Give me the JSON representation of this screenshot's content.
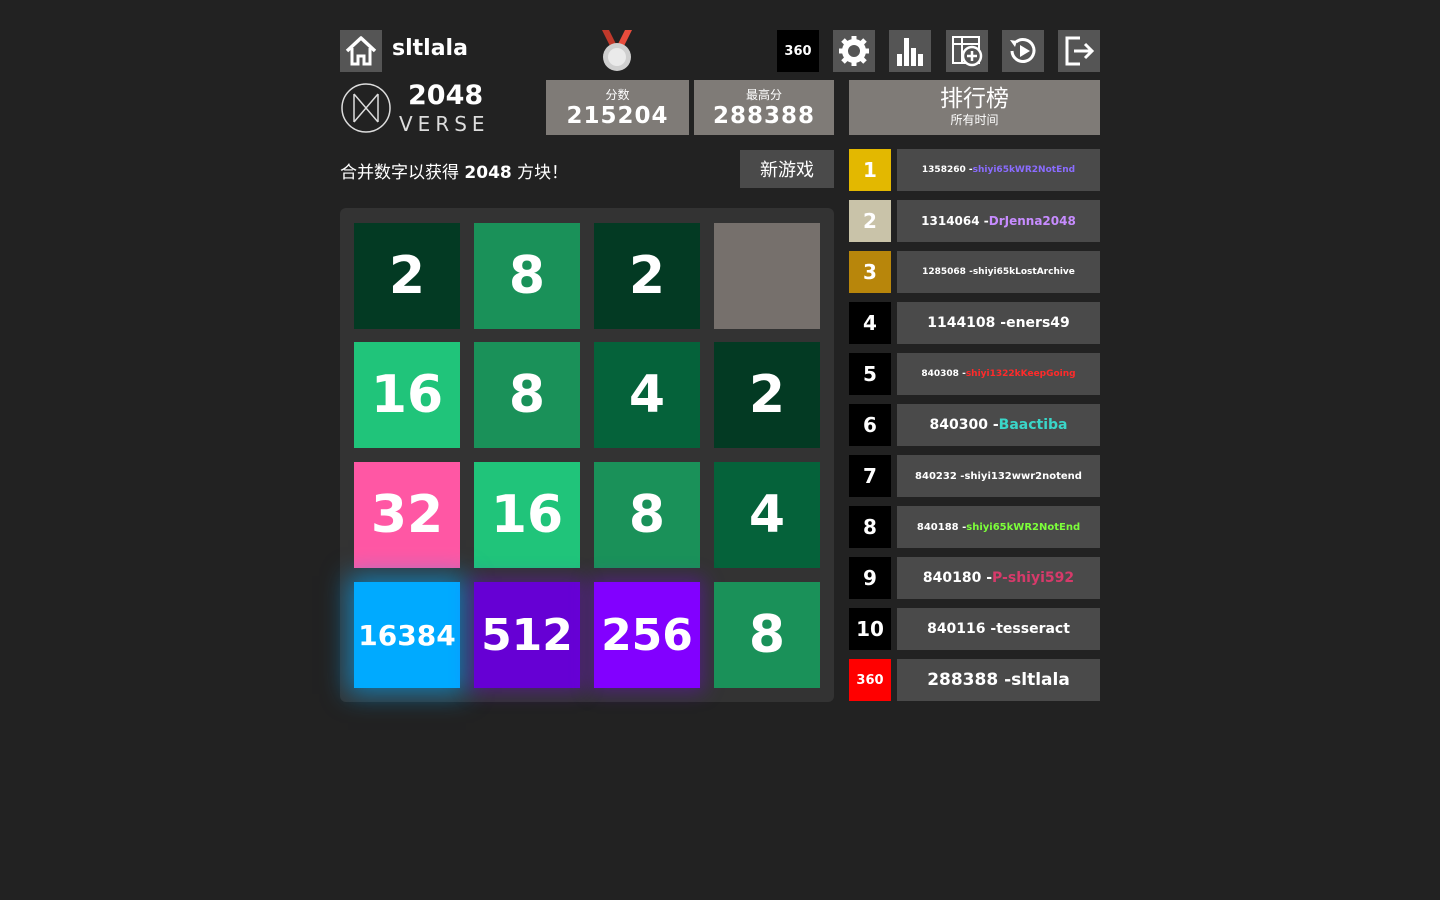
{
  "header": {
    "username": "sltlala",
    "rank_badge": "360",
    "icons": [
      "home-icon",
      "medal-icon",
      "gear-icon",
      "stats-icon",
      "grid-plus-icon",
      "replay-icon",
      "logout-icon"
    ]
  },
  "logo": {
    "number": "2048",
    "word": "VERSE"
  },
  "score": {
    "label": "分数",
    "value": "215204"
  },
  "best": {
    "label": "最高分",
    "value": "288388"
  },
  "leaderboard": {
    "title": "排行榜",
    "subtitle": "所有时间",
    "entries": [
      {
        "rank": "1",
        "score": "1358260",
        "name": "shiyi65kWR2NotEnd",
        "rank_color": "#e3b800",
        "name_color": "#8a6cff",
        "size": 9
      },
      {
        "rank": "2",
        "score": "1314064",
        "name": "DrJenna2048",
        "rank_color": "#c9c3a9",
        "name_color": "#c78cff",
        "size": 12
      },
      {
        "rank": "3",
        "score": "1285068",
        "name": "shiyi65kLostArchive",
        "rank_color": "#b8860b",
        "name_color": "#ffffff",
        "size": 9
      },
      {
        "rank": "4",
        "score": "1144108",
        "name": "eners49",
        "rank_color": "#000000",
        "name_color": "#ffffff",
        "size": 14
      },
      {
        "rank": "5",
        "score": "840308",
        "name": "shiyi1322kKeepGoing",
        "rank_color": "#000000",
        "name_color": "#ff2a2a",
        "size": 9
      },
      {
        "rank": "6",
        "score": "840300",
        "name": "Baactiba",
        "rank_color": "#000000",
        "name_color": "#3ad6c8",
        "size": 14
      },
      {
        "rank": "7",
        "score": "840232",
        "name": "shiyi132wwr2notend",
        "rank_color": "#000000",
        "name_color": "#ffffff",
        "size": 10
      },
      {
        "rank": "8",
        "score": "840188",
        "name": "shiyi65kWR2NotEnd",
        "rank_color": "#000000",
        "name_color": "#7cff3a",
        "size": 10
      },
      {
        "rank": "9",
        "score": "840180",
        "name": "P-shiyi592",
        "rank_color": "#000000",
        "name_color": "#d63a6a",
        "size": 14
      },
      {
        "rank": "10",
        "score": "840116",
        "name": "tesseract",
        "rank_color": "#000000",
        "name_color": "#ffffff",
        "size": 14
      },
      {
        "rank": "360",
        "score": "288388",
        "name": "sltlala",
        "rank_color": "#ff0000",
        "name_color": "#ffffff",
        "size": 17
      }
    ]
  },
  "instruction": {
    "prefix": "合并数字以获得 ",
    "target": "2048",
    "suffix": " 方块！"
  },
  "new_game_label": "新游戏",
  "board": [
    [
      "2",
      "8",
      "2",
      ""
    ],
    [
      "16",
      "8",
      "4",
      "2"
    ],
    [
      "32",
      "16",
      "8",
      "4"
    ],
    [
      "16384",
      "512",
      "256",
      "8"
    ]
  ],
  "tile_colors": {
    "2": "#033a23",
    "4": "#05623a",
    "8": "#1a9159",
    "16": "#20c47a",
    "32": "#ff57a4",
    "256": "#8200ff",
    "512": "#6600d4",
    "16384": "#00aaff",
    "": "#76706c"
  }
}
